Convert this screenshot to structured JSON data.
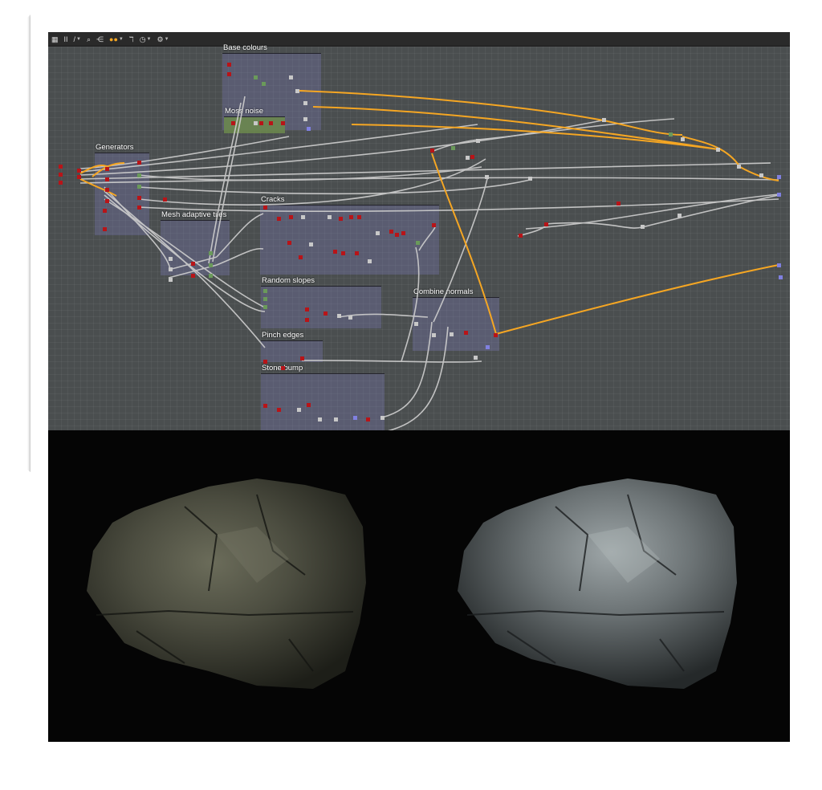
{
  "toolbar": {
    "items": [
      {
        "icon": "grid-icon",
        "label": "▦"
      },
      {
        "icon": "pause-icon",
        "label": "II"
      },
      {
        "icon": "pencil-icon",
        "label": "/"
      },
      {
        "icon": "zoom-icon",
        "label": "⌕"
      },
      {
        "icon": "share-icon",
        "label": "⋲"
      },
      {
        "icon": "link-style-icon",
        "label": "●●"
      },
      {
        "icon": "reroute-icon",
        "label": "ℸ"
      },
      {
        "icon": "timer-icon",
        "label": "◷"
      },
      {
        "icon": "settings-icon",
        "label": "⚙"
      }
    ]
  },
  "frames": [
    {
      "title": "Base colours"
    },
    {
      "title": "Moss noise"
    },
    {
      "title": "Generators"
    },
    {
      "title": "Mesh adaptive tiles"
    },
    {
      "title": "Cracks"
    },
    {
      "title": "Random slopes"
    },
    {
      "title": "Combine normals"
    },
    {
      "title": "Pinch edges"
    },
    {
      "title": "Stone bump"
    }
  ],
  "colors": {
    "graph_bg": "#4a4e4f",
    "frame_fill": "#7878af",
    "link_gray": "#cfcfcf",
    "link_orange": "#f5a623",
    "node_red": "#b81418",
    "node_green": "#6a9a5a",
    "node_gray": "#c8c8c8",
    "node_blue": "#8080e0",
    "moss_green": "#6c8a4c",
    "viewport_bg": "#050505"
  },
  "viewport": {
    "panes": [
      {
        "name": "rock-render-moss",
        "content": "mossy rock render"
      },
      {
        "name": "rock-render-clean",
        "content": "clean rock render"
      }
    ]
  }
}
